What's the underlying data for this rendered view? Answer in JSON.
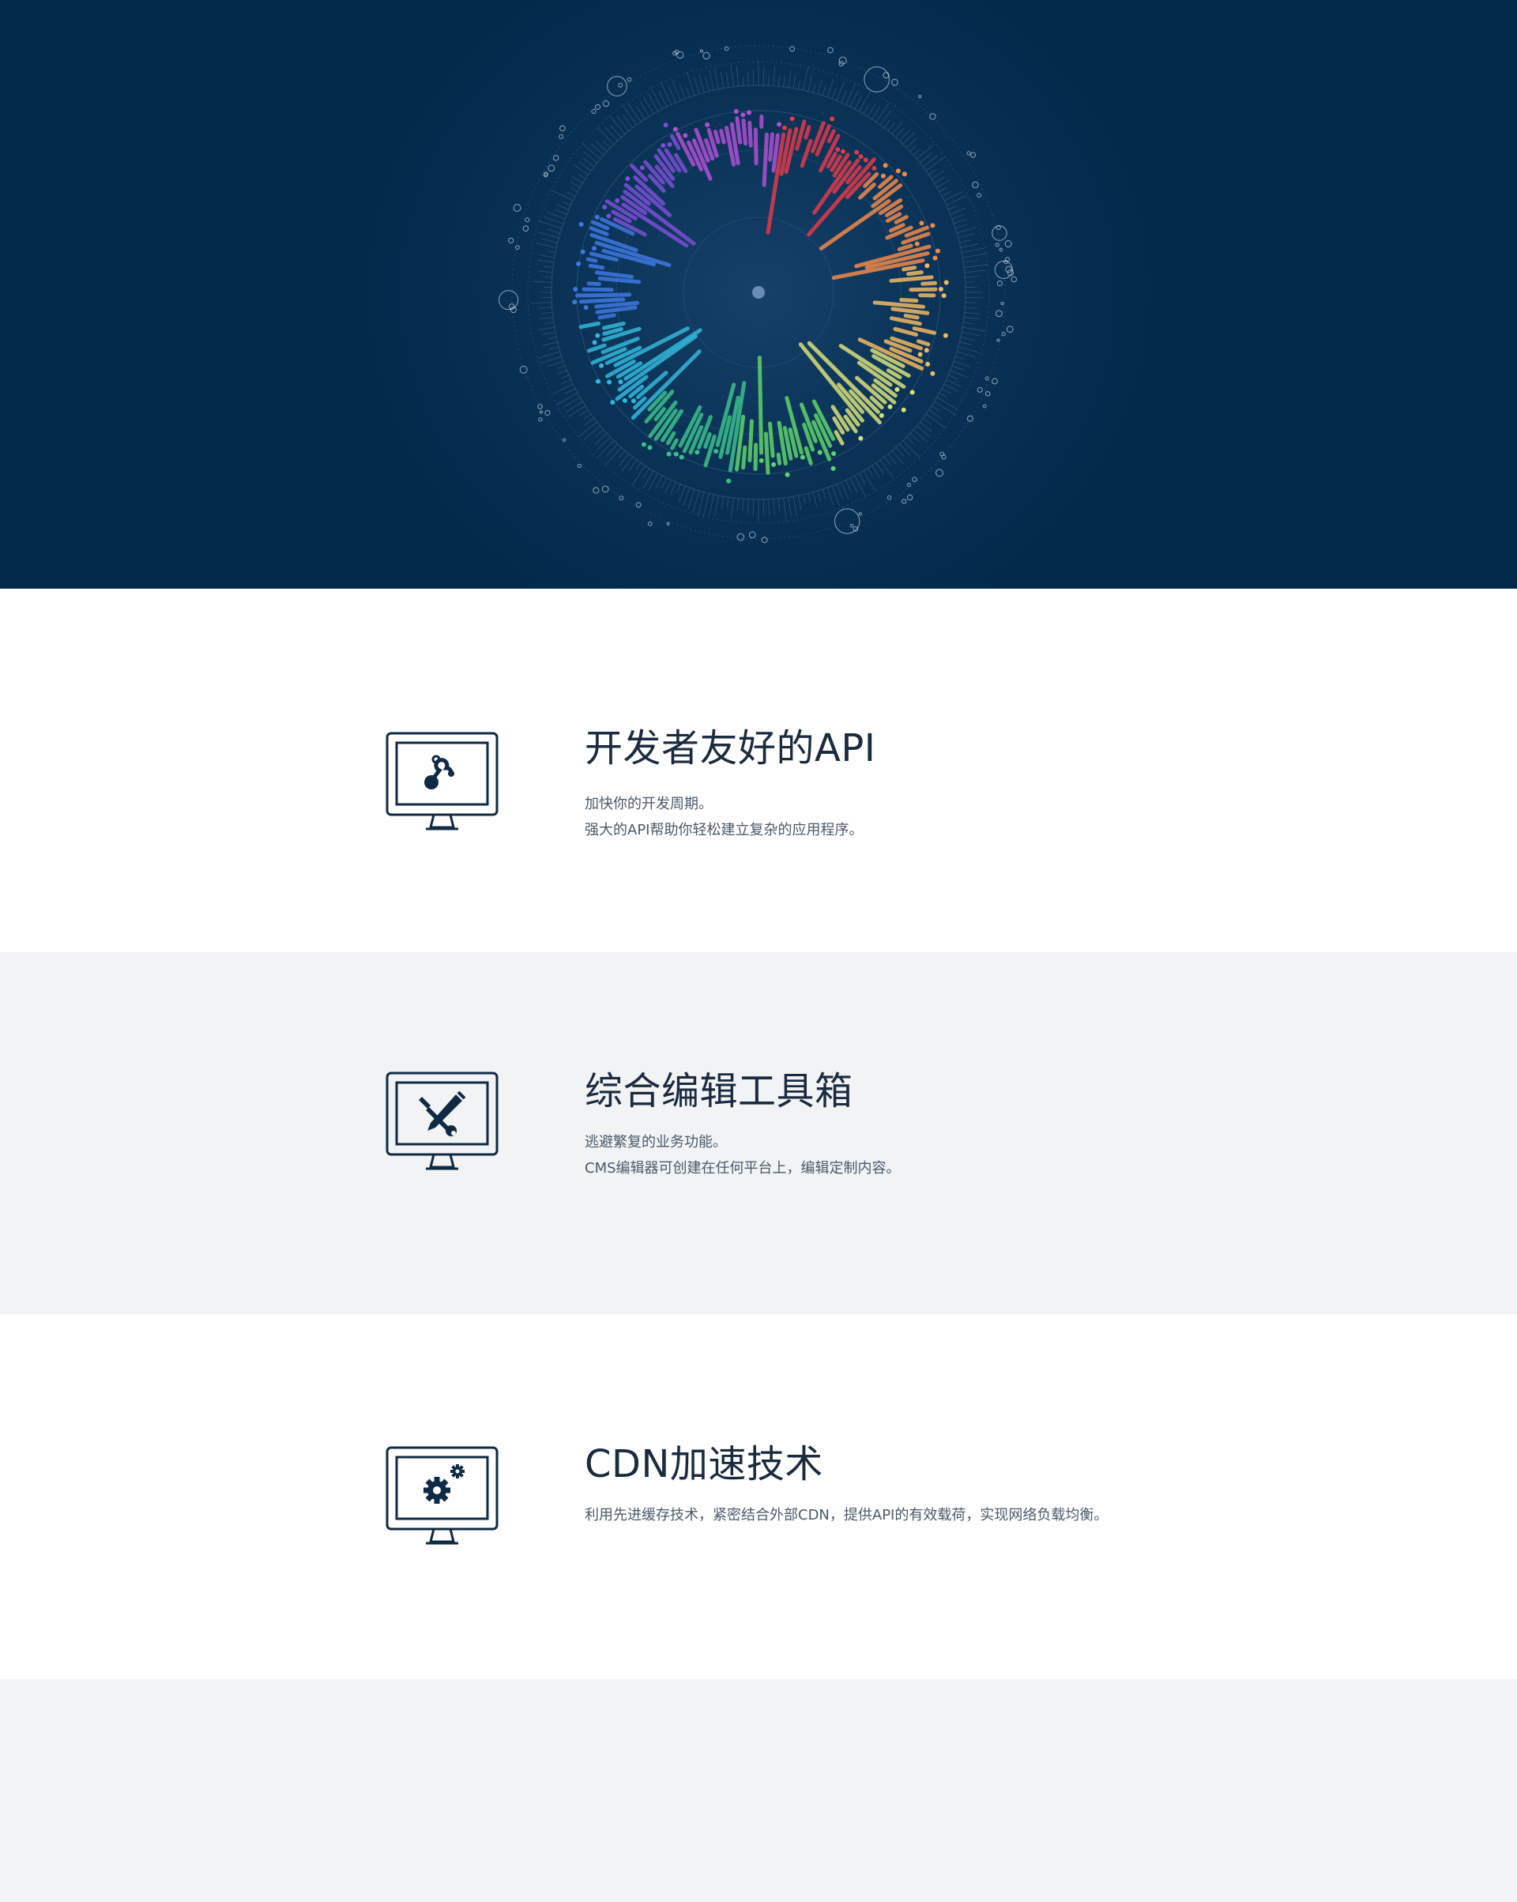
{
  "hero": {
    "colors": {
      "background": "#03294a",
      "ring_stroke": "#7a96b0",
      "spectrum": [
        "#7b4fd6",
        "#b34fd6",
        "#e23a4a",
        "#f08a4a",
        "#f2b860",
        "#d9e07a",
        "#5fd46a",
        "#3bbf8a",
        "#33b7d9",
        "#3f78e0"
      ]
    }
  },
  "features": [
    {
      "icon": "monitor-api-icon",
      "title": "开发者友好的API",
      "lines": [
        "加快你的开发周期。",
        "强大的API帮助你轻松建立复杂的应用程序。"
      ]
    },
    {
      "icon": "monitor-tools-icon",
      "title": "综合编辑工具箱",
      "lines": [
        "逃避繁复的业务功能。",
        "CMS编辑器可创建在任何平台上，编辑定制内容。"
      ]
    },
    {
      "icon": "monitor-gears-icon",
      "title": "CDN加速技术",
      "lines": [
        "利用先进缓存技术，紧密结合外部CDN，提供API的有效载荷，实现网络负载均衡。"
      ]
    }
  ],
  "colors": {
    "section_white": "#ffffff",
    "section_grey": "#f2f3f5",
    "icon": "#0f2a44",
    "title": "#1b2b3f",
    "text": "#4a5a6a"
  }
}
